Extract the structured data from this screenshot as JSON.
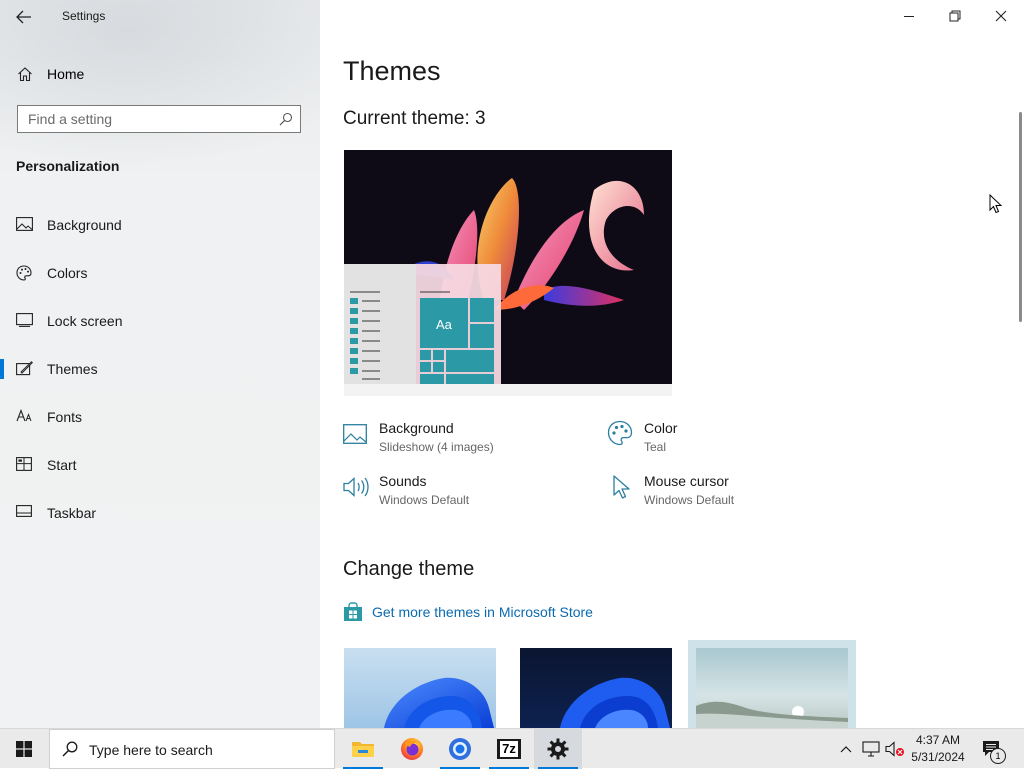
{
  "window": {
    "app_title": "Settings",
    "minimize_icon": "minimize-icon",
    "restore_icon": "restore-icon",
    "close_icon": "close-icon"
  },
  "sidebar": {
    "home_label": "Home",
    "search_placeholder": "Find a setting",
    "section_title": "Personalization",
    "items": [
      {
        "label": "Background",
        "icon": "image-icon"
      },
      {
        "label": "Colors",
        "icon": "palette-icon"
      },
      {
        "label": "Lock screen",
        "icon": "lock-screen-icon"
      },
      {
        "label": "Themes",
        "icon": "themes-icon",
        "selected": true
      },
      {
        "label": "Fonts",
        "icon": "fonts-icon"
      },
      {
        "label": "Start",
        "icon": "start-icon"
      },
      {
        "label": "Taskbar",
        "icon": "taskbar-icon"
      }
    ]
  },
  "main": {
    "title": "Themes",
    "current_theme": "Current theme: 3",
    "properties": [
      {
        "title": "Background",
        "value": "Slideshow (4 images)",
        "icon": "image-icon"
      },
      {
        "title": "Color",
        "value": "Teal",
        "icon": "palette-icon"
      },
      {
        "title": "Sounds",
        "value": "Windows Default",
        "icon": "speaker-icon"
      },
      {
        "title": "Mouse cursor",
        "value": "Windows Default",
        "icon": "mouse-pointer-icon"
      }
    ],
    "change_theme_title": "Change theme",
    "store_link": "Get more themes in Microsoft Store",
    "preview_tile_label": "Aa"
  },
  "taskbar": {
    "search_text": "Type here to search",
    "apps": [
      {
        "name": "File Explorer",
        "icon": "folder-icon"
      },
      {
        "name": "Firefox",
        "icon": "firefox-icon"
      },
      {
        "name": "Chrome",
        "icon": "chrome-icon"
      },
      {
        "name": "7-Zip",
        "icon": "7zip-icon",
        "label": "7z"
      },
      {
        "name": "Settings",
        "icon": "gear-icon",
        "active": true
      }
    ],
    "time": "4:37 AM",
    "date": "5/31/2024",
    "notification_count": "1"
  },
  "colors": {
    "accent": "#0078d7",
    "teal": "#2b9aa6",
    "link": "#0a6bb0"
  }
}
